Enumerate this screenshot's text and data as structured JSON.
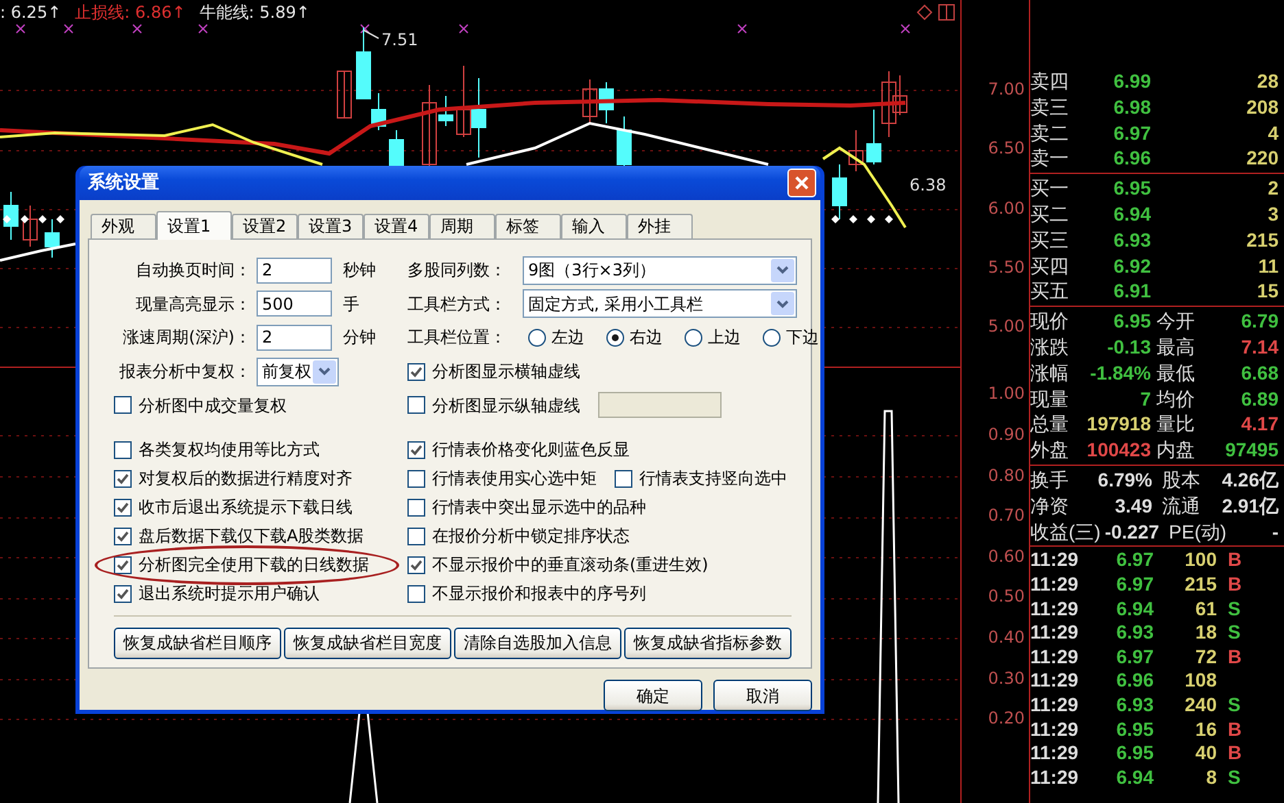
{
  "chart": {
    "legend": [
      {
        "text": ": 6.25↑",
        "color": "#e8e8e8"
      },
      {
        "text": "止损线: 6.86↑",
        "color": "#e03030"
      },
      {
        "text": "牛能线: 5.89↑",
        "color": "#e8e8e8"
      }
    ],
    "price_labels": [
      {
        "text": "7.51",
        "kind": "high"
      },
      {
        "text": "6.38",
        "kind": "last"
      }
    ],
    "axis_upper": [
      "7.00",
      "6.50",
      "6.00",
      "5.50",
      "5.00"
    ],
    "axis_lower": [
      "1.00",
      "0.90",
      "0.80",
      "0.70",
      "0.60",
      "0.50",
      "0.40",
      "0.30",
      "0.20"
    ]
  },
  "quote": {
    "asks": [
      {
        "label": "卖四",
        "price": "6.99",
        "volume": "28"
      },
      {
        "label": "卖三",
        "price": "6.98",
        "volume": "208"
      },
      {
        "label": "卖二",
        "price": "6.97",
        "volume": "4"
      },
      {
        "label": "卖一",
        "price": "6.96",
        "volume": "220"
      }
    ],
    "bids": [
      {
        "label": "买一",
        "price": "6.95",
        "volume": "2"
      },
      {
        "label": "买二",
        "price": "6.94",
        "volume": "3"
      },
      {
        "label": "买三",
        "price": "6.93",
        "volume": "215"
      },
      {
        "label": "买四",
        "price": "6.92",
        "volume": "11"
      },
      {
        "label": "买五",
        "price": "6.91",
        "volume": "15"
      }
    ],
    "stats": [
      {
        "label": "现价",
        "value": "6.95",
        "color": "#40c040"
      },
      {
        "label": "今开",
        "value": "6.79",
        "color": "#40c040"
      },
      {
        "label": "涨跌",
        "value": "-0.13",
        "color": "#40c040"
      },
      {
        "label": "最高",
        "value": "7.14",
        "color": "#e04848"
      },
      {
        "label": "涨幅",
        "value": "-1.84%",
        "color": "#40c040"
      },
      {
        "label": "最低",
        "value": "6.68",
        "color": "#40c040"
      },
      {
        "label": "现量",
        "value": "7",
        "color": "#40c040"
      },
      {
        "label": "均价",
        "value": "6.89",
        "color": "#40c040"
      },
      {
        "label": "总量",
        "value": "197918",
        "color": "#d8d070"
      },
      {
        "label": "量比",
        "value": "4.17",
        "color": "#e04848"
      },
      {
        "label": "外盘",
        "value": "100423",
        "color": "#e04848"
      },
      {
        "label": "内盘",
        "value": "97495",
        "color": "#40c040"
      }
    ],
    "finance": [
      {
        "label": "换手",
        "value": "6.79%",
        "label2": "股本",
        "value2": "4.26亿"
      },
      {
        "label": "净资",
        "value": "3.49",
        "label2": "流通",
        "value2": "2.91亿"
      },
      {
        "label": "收益(三)",
        "value": "-0.227",
        "label2": "PE(动)",
        "value2": "-"
      }
    ],
    "ticks": [
      {
        "time": "11:29",
        "price": "6.97",
        "volume": "100",
        "side": "B",
        "kind": "buy"
      },
      {
        "time": "11:29",
        "price": "6.97",
        "volume": "215",
        "side": "B",
        "kind": "buy"
      },
      {
        "time": "11:29",
        "price": "6.94",
        "volume": "61",
        "side": "S",
        "kind": "sell"
      },
      {
        "time": "11:29",
        "price": "6.93",
        "volume": "18",
        "side": "S",
        "kind": "sell"
      },
      {
        "time": "11:29",
        "price": "6.97",
        "volume": "72",
        "side": "B",
        "kind": "buy"
      },
      {
        "time": "11:29",
        "price": "6.96",
        "volume": "108",
        "kind": "none"
      },
      {
        "time": "11:29",
        "price": "6.93",
        "volume": "240",
        "side": "S",
        "kind": "sell"
      },
      {
        "time": "11:29",
        "price": "6.95",
        "volume": "16",
        "side": "B",
        "kind": "buy"
      },
      {
        "time": "11:29",
        "price": "6.95",
        "volume": "40",
        "side": "B",
        "kind": "buy"
      },
      {
        "time": "11:29",
        "price": "6.94",
        "volume": "8",
        "side": "S",
        "kind": "sell"
      }
    ]
  },
  "dialog": {
    "title": "系统设置",
    "tabs": [
      {
        "label": "外观",
        "selected": false
      },
      {
        "label": "设置1",
        "selected": true
      },
      {
        "label": "设置2",
        "selected": false
      },
      {
        "label": "设置3",
        "selected": false
      },
      {
        "label": "设置4",
        "selected": false
      },
      {
        "label": "周期",
        "selected": false
      },
      {
        "label": "标签",
        "selected": false
      },
      {
        "label": "输入",
        "selected": false
      },
      {
        "label": "外挂",
        "selected": false
      }
    ],
    "upper": {
      "left": [
        {
          "kind": "input",
          "label": "自动换页时间：",
          "value": "2",
          "unit": "秒钟"
        },
        {
          "kind": "input",
          "label": "现量高亮显示：",
          "value": "500",
          "unit": "手"
        },
        {
          "kind": "input",
          "label": "涨速周期(深沪)：",
          "value": "2",
          "unit": "分钟"
        },
        {
          "kind": "select",
          "label": "报表分析中复权：",
          "value": "前复权"
        },
        {
          "kind": "checkbox",
          "checks": [
            {
              "label": "分析图中成交量复权",
              "checked": false
            }
          ]
        }
      ],
      "right": [
        {
          "kind": "select",
          "label": "多股同列数：",
          "value": "9图（3行×3列）"
        },
        {
          "kind": "select",
          "label": "工具栏方式：",
          "value": "固定方式, 采用小工具栏"
        },
        {
          "kind": "radios",
          "label": "工具栏位置：",
          "options": [
            {
              "label": "左边",
              "selected": false
            },
            {
              "label": "右边",
              "selected": true
            },
            {
              "label": "上边",
              "selected": false
            },
            {
              "label": "下边",
              "selected": false
            }
          ]
        },
        {
          "kind": "checkbox",
          "checks": [
            {
              "label": "分析图显示横轴虚线",
              "checked": true
            }
          ]
        },
        {
          "kind": "checkbox",
          "checks": [
            {
              "label": "分析图显示纵轴虚线",
              "checked": false
            }
          ],
          "field": {
            "disabled": true
          }
        }
      ]
    },
    "lower": {
      "left": [
        {
          "label": "各类复权均使用等比方式",
          "checked": false,
          "circled": false
        },
        {
          "label": "对复权后的数据进行精度对齐",
          "checked": true,
          "circled": false
        },
        {
          "label": "收市后退出系统提示下载日线",
          "checked": true,
          "circled": false
        },
        {
          "label": "盘后数据下载仅下载A股类数据",
          "checked": true,
          "circled": false
        },
        {
          "label": "分析图完全使用下载的日线数据",
          "checked": true,
          "circled": true
        },
        {
          "label": "退出系统时提示用户确认",
          "checked": true,
          "circled": false
        }
      ],
      "right": [
        {
          "checks": [
            {
              "label": "行情表价格变化则蓝色反显",
              "checked": true
            }
          ]
        },
        {
          "checks": [
            {
              "label": "行情表使用实心选中矩",
              "checked": false
            },
            {
              "label": "行情表支持竖向选中",
              "checked": false
            }
          ]
        },
        {
          "checks": [
            {
              "label": "行情表中突出显示选中的品种",
              "checked": false
            }
          ]
        },
        {
          "checks": [
            {
              "label": "在报价分析中锁定排序状态",
              "checked": false
            }
          ]
        },
        {
          "checks": [
            {
              "label": "不显示报价中的垂直滚动条(重进生效)",
              "checked": true
            }
          ]
        },
        {
          "checks": [
            {
              "label": "不显示报价和报表中的序号列",
              "checked": false
            }
          ]
        }
      ]
    },
    "actions": [
      "恢复成缺省栏目顺序",
      "恢复成缺省栏目宽度",
      "清除自选股加入信息",
      "恢复成缺省指标参数"
    ],
    "buttons": [
      "确定",
      "取消"
    ]
  }
}
